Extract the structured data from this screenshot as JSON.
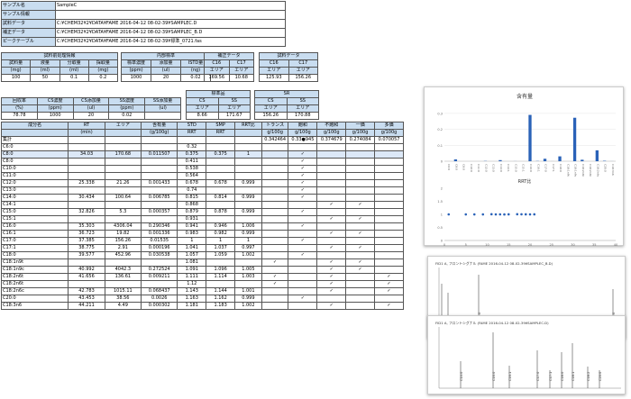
{
  "info": [
    {
      "key": "サンプル名",
      "value": "SampleC"
    },
    {
      "key": "サンプル情報",
      "value": ""
    },
    {
      "key": "試料データ",
      "value": "C:¥CHEM32¥2¥DATA¥FAME 2016-04-12 08-02-39¥SAMPLEC.D"
    },
    {
      "key": "補正データ",
      "value": "C:¥CHEM32¥2¥DATA¥FAME 2016-04-12 08-02-39¥SAMPLEC_B.D"
    },
    {
      "key": "ピークテーブル",
      "value": "C:¥CHEM32¥2¥DATA¥FAME 2016-04-12 08-02-39¥標準_0721.fas"
    }
  ],
  "pretreat": {
    "title": "試料前処理情報",
    "headers": [
      "試料量",
      "液量",
      "分取量",
      "採取量"
    ],
    "units": [
      "(mg)",
      "(ml)",
      "(ml)",
      "(mg)"
    ],
    "values": [
      "100",
      "50",
      "0.1",
      "0.2"
    ]
  },
  "internal": {
    "title": "内部標準",
    "headers": [
      "標準濃度",
      "添加量",
      "ISTD量"
    ],
    "units": [
      "(ppm)",
      "(ul)",
      "(ng)"
    ],
    "values": [
      "1000",
      "20",
      "0.02"
    ]
  },
  "corr": {
    "title": "補正データ",
    "headers": [
      "C16",
      "C17"
    ],
    "units": [
      "エリア",
      "エリア"
    ],
    "values": [
      "169.56",
      "10.68"
    ]
  },
  "sample": {
    "title": "試料データ",
    "headers": [
      "C16",
      "C17"
    ],
    "units": [
      "エリア",
      "エリア"
    ],
    "values": [
      "125.93",
      "156.26"
    ]
  },
  "recovery": {
    "headers": [
      "回収率",
      "CS濃度",
      "CS添加量",
      "SS濃度",
      "SS添加量"
    ],
    "units": [
      "(%)",
      "(ppm)",
      "(ul)",
      "(ppm)",
      "(ul)"
    ],
    "values": [
      "78.78",
      "1000",
      "20",
      "0.02",
      ""
    ]
  },
  "std": {
    "title": "標準品",
    "headers": [
      "CS",
      "SS"
    ],
    "units": [
      "エリア",
      "エリア"
    ],
    "values": [
      "8.66",
      "171.67"
    ]
  },
  "sr": {
    "title": "SR",
    "headers": [
      "CS",
      "SS"
    ],
    "units": [
      "エリア",
      "エリア"
    ],
    "values": [
      "156.26",
      "170.88"
    ]
  },
  "main": {
    "headers": [
      "成分名",
      "RT",
      "エリア",
      "含有量",
      "STD",
      "SMP",
      "RRT比",
      "トランス",
      "飽和",
      "不飽和",
      "一価",
      "多価"
    ],
    "units": [
      "",
      "(min)",
      "",
      "(g/100g)",
      "RRT",
      "RRT",
      "",
      "g/100g",
      "g/100g",
      "g/100g",
      "g/100g",
      "g/100g"
    ],
    "total_label": "集計",
    "totals": [
      "0.342464",
      "0.33●945",
      "0.374679",
      "0.274084",
      "0.070057"
    ],
    "rows": [
      [
        "C6:0",
        "",
        "",
        "",
        "0.32",
        "",
        "",
        "",
        "",
        "",
        "",
        ""
      ],
      [
        "C8:0",
        "34.03",
        "170.68",
        "0.011507",
        "0.375",
        "0.375",
        "1",
        "",
        "✓",
        "",
        "",
        ""
      ],
      [
        "C8:0",
        "",
        "",
        "",
        "0.411",
        "",
        "",
        "",
        "✓",
        "",
        "",
        ""
      ],
      [
        "C10:0",
        "",
        "",
        "",
        "0.538",
        "",
        "",
        "",
        "✓",
        "",
        "",
        ""
      ],
      [
        "C11:0",
        "",
        "",
        "",
        "0.564",
        "",
        "",
        "",
        "✓",
        "",
        "",
        ""
      ],
      [
        "C12:0",
        "25.338",
        "21.26",
        "0.001433",
        "0.678",
        "0.678",
        "0.999",
        "",
        "✓",
        "",
        "",
        ""
      ],
      [
        "C13:0",
        "",
        "",
        "",
        "0.74",
        "",
        "",
        "",
        "✓",
        "",
        "",
        ""
      ],
      [
        "C14:0",
        "30.434",
        "100.64",
        "0.006785",
        "0.815",
        "0.814",
        "0.999",
        "",
        "✓",
        "",
        "",
        ""
      ],
      [
        "C14:1",
        "",
        "",
        "",
        "0.868",
        "",
        "",
        "",
        "",
        "✓",
        "✓",
        ""
      ],
      [
        "C15:0",
        "32.826",
        "5.3",
        "0.000357",
        "0.879",
        "0.878",
        "0.999",
        "",
        "✓",
        "",
        "",
        ""
      ],
      [
        "C15:1",
        "",
        "",
        "",
        "0.931",
        "",
        "",
        "",
        "",
        "✓",
        "✓",
        ""
      ],
      [
        "C16:0",
        "35.303",
        "4306.04",
        "0.290346",
        "0.941",
        "0.946",
        "1.006",
        "",
        "✓",
        "",
        "",
        ""
      ],
      [
        "C16:1",
        "36.723",
        "19.82",
        "0.001336",
        "0.983",
        "0.982",
        "0.999",
        "",
        "",
        "✓",
        "✓",
        ""
      ],
      [
        "C17:0",
        "37.385",
        "156.26",
        "0.01535",
        "1",
        "1",
        "1",
        "",
        "✓",
        "",
        "",
        ""
      ],
      [
        "C17:1",
        "38.775",
        "2.91",
        "0.000196",
        "1.041",
        "1.037",
        "0.997",
        "",
        "",
        "✓",
        "✓",
        ""
      ],
      [
        "C18:0",
        "39.577",
        "452.96",
        "0.030538",
        "1.057",
        "1.059",
        "1.002",
        "",
        "✓",
        "",
        "",
        ""
      ],
      [
        "C18:1n9t",
        "",
        "",
        "",
        "1.081",
        "",
        "",
        "✓",
        "",
        "✓",
        "✓",
        ""
      ],
      [
        "C18:1n9c",
        "40.992",
        "4042.3",
        "0.272524",
        "1.091",
        "1.096",
        "1.005",
        "",
        "",
        "✓",
        "✓",
        ""
      ],
      [
        "C18:2n6t",
        "41.656",
        "136.61",
        "0.009211",
        "1.111",
        "1.114",
        "1.003",
        "✓",
        "",
        "✓",
        "",
        "✓"
      ],
      [
        "C18:2n6t",
        "",
        "",
        "",
        "1.12",
        "",
        "",
        "✓",
        "",
        "✓",
        "",
        "✓"
      ],
      [
        "C18:2n6c",
        "42.783",
        "1015.11",
        "0.068437",
        "1.143",
        "1.144",
        "1.001",
        "",
        "",
        "✓",
        "",
        "✓"
      ],
      [
        "C20:0",
        "43.453",
        "38.56",
        "0.0026",
        "1.163",
        "1.162",
        "0.999",
        "",
        "✓",
        "",
        "",
        ""
      ],
      [
        "C18:3n6",
        "44.211",
        "4.49",
        "0.000302",
        "1.181",
        "1.183",
        "1.002",
        "",
        "",
        "✓",
        "",
        "✓"
      ]
    ]
  },
  "bar_chart": {
    "title": "含有量"
  },
  "rrt_chart": {
    "title": "RRT比"
  },
  "chrom1": {
    "header": "FID1 A, フロントシグナル (FAME 2016-04-12 08-02-39¥SAMPLEC_B.D)",
    "peaks": [
      "C16:0",
      "C17:0"
    ]
  },
  "chrom2": {
    "header": "FID1 A, フロントシグナル (FAME 2016-04-12 08-02-39¥SAMPLEC.D)",
    "peaks": [
      "C14:0",
      "C16:0",
      "C16:1",
      "C17:0",
      "C17:1",
      "C18:0",
      "C18:1",
      "C18:2",
      "C20:0"
    ]
  },
  "chart_data": [
    {
      "type": "bar",
      "title": "含有量",
      "categories": [
        "C6:0",
        "C8:0",
        "C8:0",
        "C10:0",
        "C11:0",
        "C12:0",
        "C13:0",
        "C14:0",
        "C14:1",
        "C15:0",
        "C15:1",
        "C16:0",
        "C16:1",
        "C17:0",
        "C17:1",
        "C18:0",
        "C18:1n9t",
        "C18:1n9c",
        "C18:2n6t",
        "C18:2n6t",
        "C18:2n6c",
        "C20:0",
        "C18:3n6"
      ],
      "values": [
        0,
        0.0115,
        0,
        0,
        0,
        0.0014,
        0,
        0.0068,
        0,
        0.0004,
        0,
        0.2903,
        0.0013,
        0.0154,
        0.0002,
        0.0305,
        0,
        0.2725,
        0.0092,
        0,
        0.0684,
        0.0026,
        0.0003
      ],
      "ylim": [
        0,
        0.35
      ]
    },
    {
      "type": "scatter",
      "title": "RRT比",
      "x": [
        1,
        5,
        7,
        9,
        11,
        12,
        13,
        14,
        15,
        17,
        18,
        19,
        20,
        21
      ],
      "y": [
        1,
        0.999,
        0.999,
        0.999,
        1.006,
        0.999,
        1,
        0.997,
        1.002,
        1.005,
        1.003,
        1.001,
        0.999,
        1.002
      ],
      "xlim": [
        0,
        40
      ],
      "ylim": [
        0,
        2
      ]
    }
  ]
}
